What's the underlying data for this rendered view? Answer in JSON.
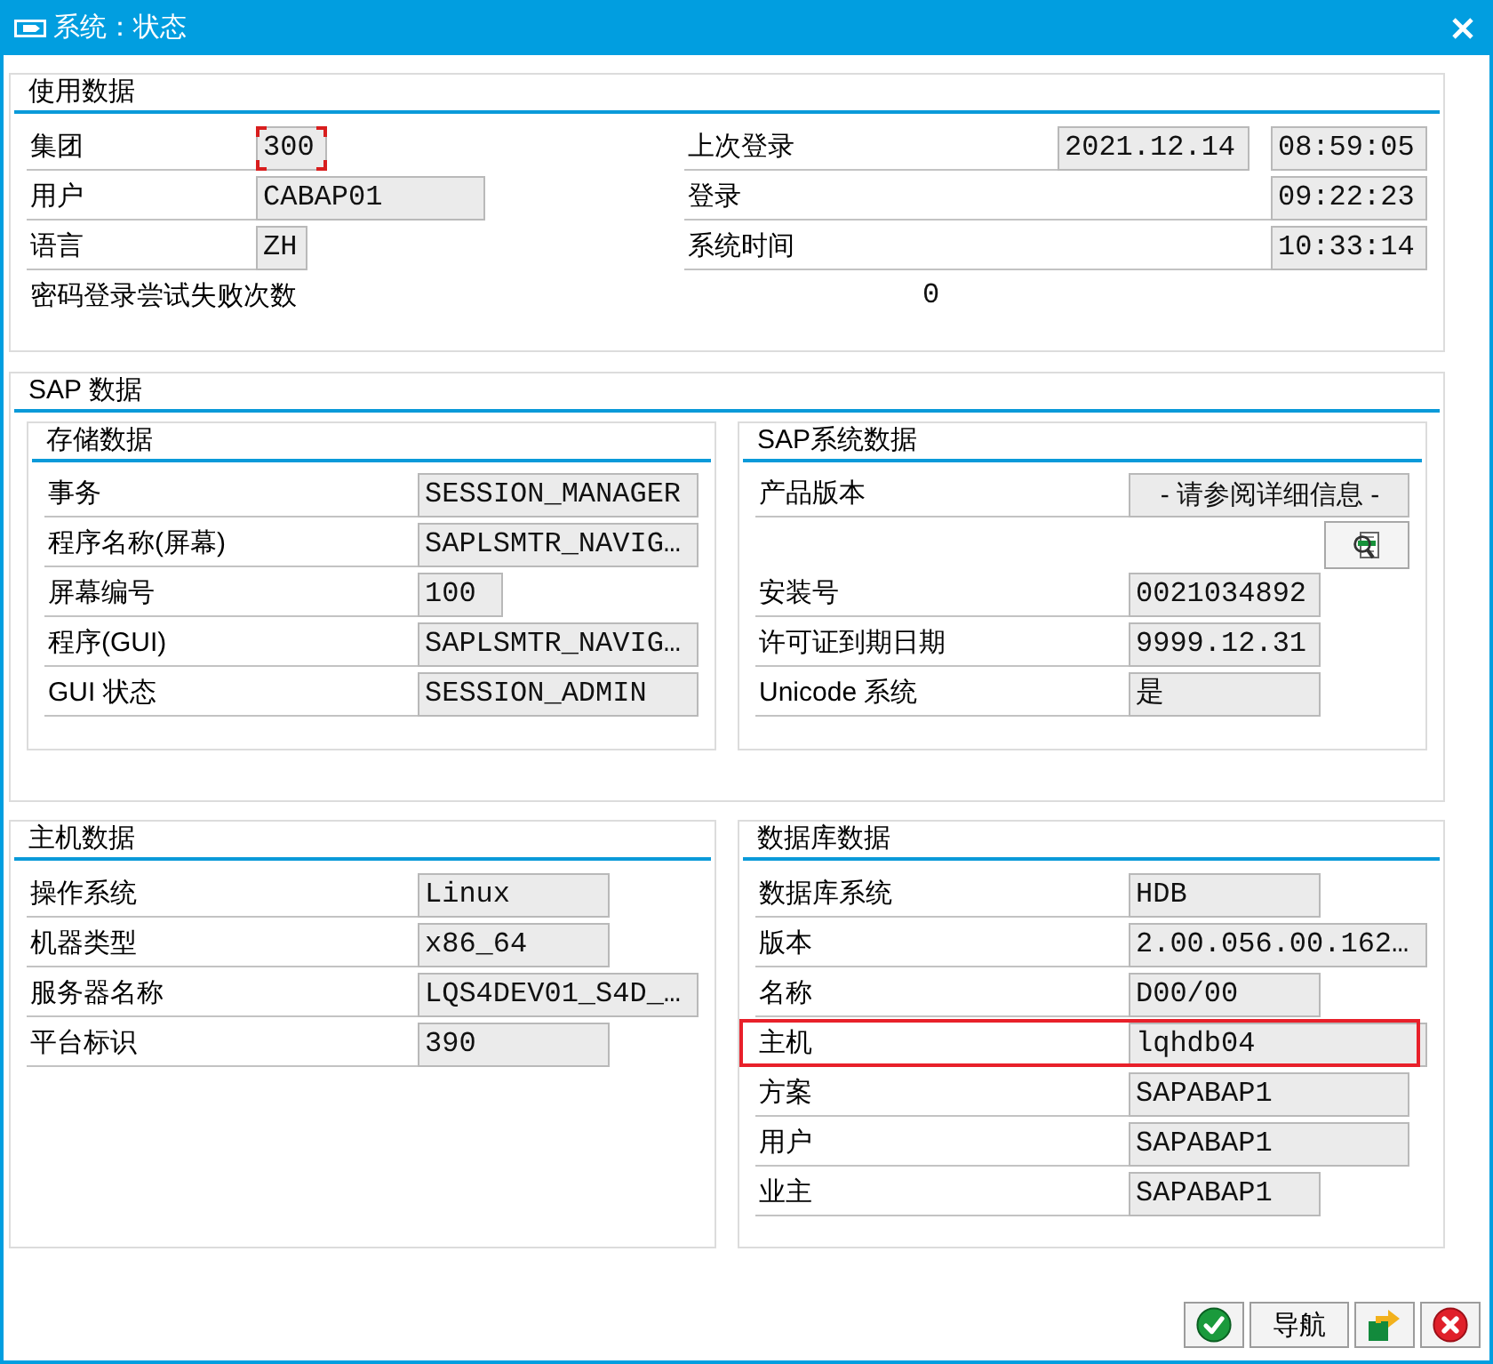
{
  "window": {
    "title": "系统：状态"
  },
  "usage_data": {
    "title": "使用数据",
    "user_fields": [
      {
        "label": "集团",
        "value": "300",
        "focused": true
      },
      {
        "label": "用户",
        "value": "CABAP01",
        "focused": false
      },
      {
        "label": "语言",
        "value": "ZH",
        "focused": false
      }
    ],
    "login_times": [
      {
        "label": "上次登录",
        "date": "2021.12.14",
        "time": "08:59:05"
      },
      {
        "label": "登录",
        "time": "09:22:23"
      },
      {
        "label": "系统时间",
        "time": "10:33:14"
      }
    ],
    "failed_logins": {
      "label": "密码登录尝试失败次数",
      "value": "0"
    }
  },
  "sap_data": {
    "title": "SAP 数据",
    "storage_data": {
      "title": "存储数据",
      "rows": [
        {
          "label": "事务",
          "value": "SESSION_MANAGER"
        },
        {
          "label": "程序名称(屏幕)",
          "value": "SAPLSMTR_NAVIG…"
        },
        {
          "label": "屏幕编号",
          "value": "100"
        },
        {
          "label": "程序(GUI)",
          "value": "SAPLSMTR_NAVIG…"
        },
        {
          "label": "GUI 状态",
          "value": "SESSION_ADMIN"
        }
      ]
    },
    "system_data": {
      "title": "SAP系统数据",
      "rows": [
        {
          "kind": "note",
          "label": "产品版本",
          "value": "- 请参阅详细信息 -"
        },
        {
          "kind": "button"
        },
        {
          "kind": "field",
          "label": "安装号",
          "value": "0021034892"
        },
        {
          "kind": "field",
          "label": "许可证到期日期",
          "value": "9999.12.31"
        },
        {
          "kind": "field",
          "label": "Unicode 系统",
          "value": "是"
        }
      ]
    }
  },
  "host_data": {
    "title": "主机数据",
    "rows": [
      {
        "label": "操作系统",
        "value": "Linux"
      },
      {
        "label": "机器类型",
        "value": "x86_64"
      },
      {
        "label": "服务器名称",
        "value": "LQS4DEV01_S4D_…"
      },
      {
        "label": "平台标识",
        "value": "390"
      }
    ]
  },
  "database_data": {
    "title": "数据库数据",
    "rows": [
      {
        "label": "数据库系统",
        "value": "HDB",
        "highlighted": false
      },
      {
        "label": "版本",
        "value": "2.00.056.00.162…",
        "highlighted": false
      },
      {
        "label": "名称",
        "value": "D00/00",
        "highlighted": false
      },
      {
        "label": "主机",
        "value": "lqhdb04",
        "highlighted": true
      },
      {
        "label": "方案",
        "value": "SAPABAP1",
        "highlighted": false
      },
      {
        "label": "用户",
        "value": "SAPABAP1",
        "highlighted": false
      },
      {
        "label": "业主",
        "value": "SAPABAP1",
        "highlighted": false
      }
    ]
  },
  "buttons": [
    {
      "kind": "confirm"
    },
    {
      "kind": "text",
      "label": "导航"
    },
    {
      "kind": "transfer"
    },
    {
      "kind": "cancel"
    }
  ]
}
